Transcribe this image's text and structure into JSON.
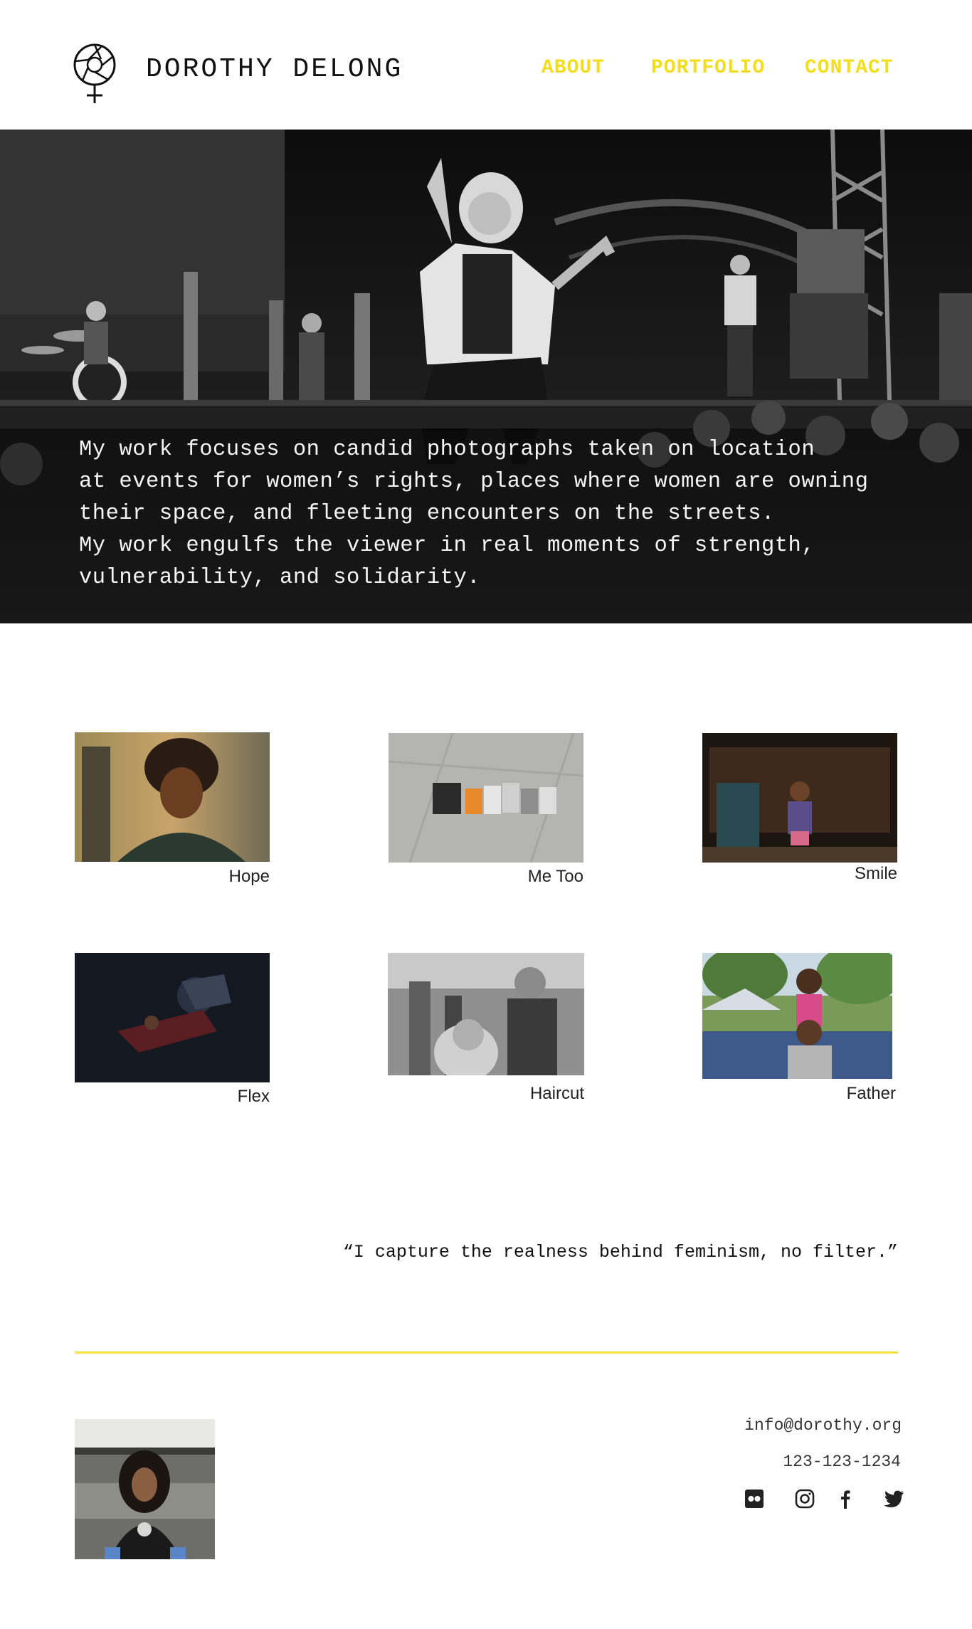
{
  "header": {
    "brand": "DOROTHY DELONG",
    "nav": [
      "ABOUT",
      "PORTFOLIO",
      "CONTACT"
    ]
  },
  "hero": {
    "lines": [
      "My work focuses on candid photographs taken on location",
      "at events for women’s rights, places where women are owning",
      "their space, and fleeting encounters on the streets.",
      "My work engulfs the viewer in real moments of strength,",
      "vulnerability, and solidarity."
    ]
  },
  "gallery": [
    {
      "caption": "Hope"
    },
    {
      "caption": "Me Too"
    },
    {
      "caption": "Smile"
    },
    {
      "caption": "Flex"
    },
    {
      "caption": "Haircut"
    },
    {
      "caption": "Father"
    }
  ],
  "quote": "“I capture the realness behind feminism, no filter.”",
  "footer": {
    "email": "info@dorothy.org",
    "phone": "123-123-1234",
    "social_icons": [
      "flickr-icon",
      "instagram-icon",
      "facebook-icon",
      "twitter-icon"
    ]
  },
  "colors": {
    "accent": "#f2de1c",
    "divider": "#f2e23a",
    "text": "#111111",
    "background": "#ffffff"
  }
}
